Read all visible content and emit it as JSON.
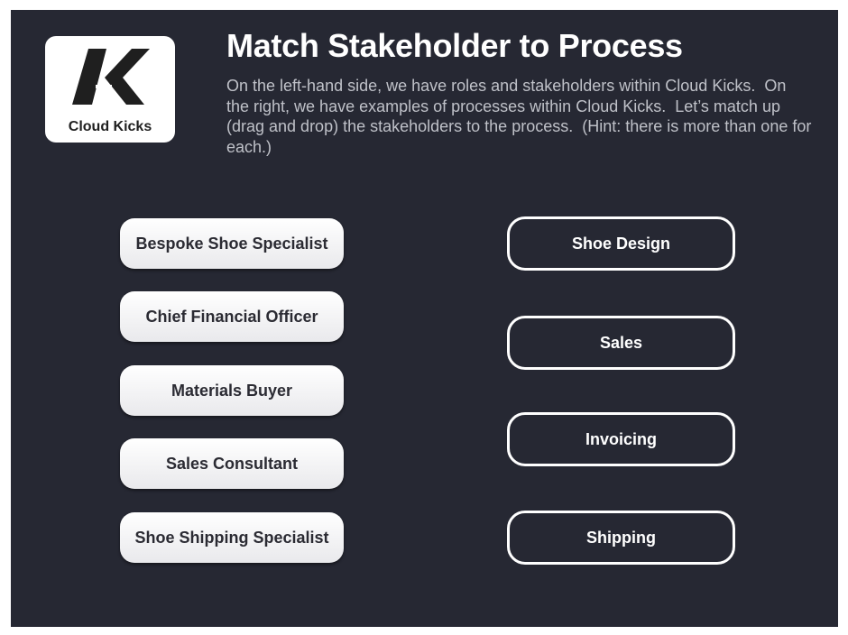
{
  "logo": {
    "icon": "cloud-kicks-logo-icon",
    "text": "Cloud Kicks"
  },
  "header": {
    "title": "Match Stakeholder to Process",
    "instructions": "On the left-hand side, we have roles and stakeholders within Cloud Kicks.  On the right, we have examples of processes within Cloud Kicks.  Let’s match up (drag and drop) the stakeholders to the process.  (Hint: there is more than one for each.)"
  },
  "stakeholders": [
    {
      "label": "Bespoke Shoe Specialist"
    },
    {
      "label": "Chief Financial Officer"
    },
    {
      "label": "Materials Buyer"
    },
    {
      "label": "Sales Consultant"
    },
    {
      "label": "Shoe Shipping Specialist"
    }
  ],
  "processes": [
    {
      "label": "Shoe Design"
    },
    {
      "label": "Sales"
    },
    {
      "label": "Invoicing"
    },
    {
      "label": "Shipping"
    }
  ],
  "colors": {
    "background": "#262833",
    "card": "#f1f1f3",
    "card_text": "#2b2b33",
    "process_border": "#ffffff",
    "instruction_text": "#bfc1c8"
  }
}
